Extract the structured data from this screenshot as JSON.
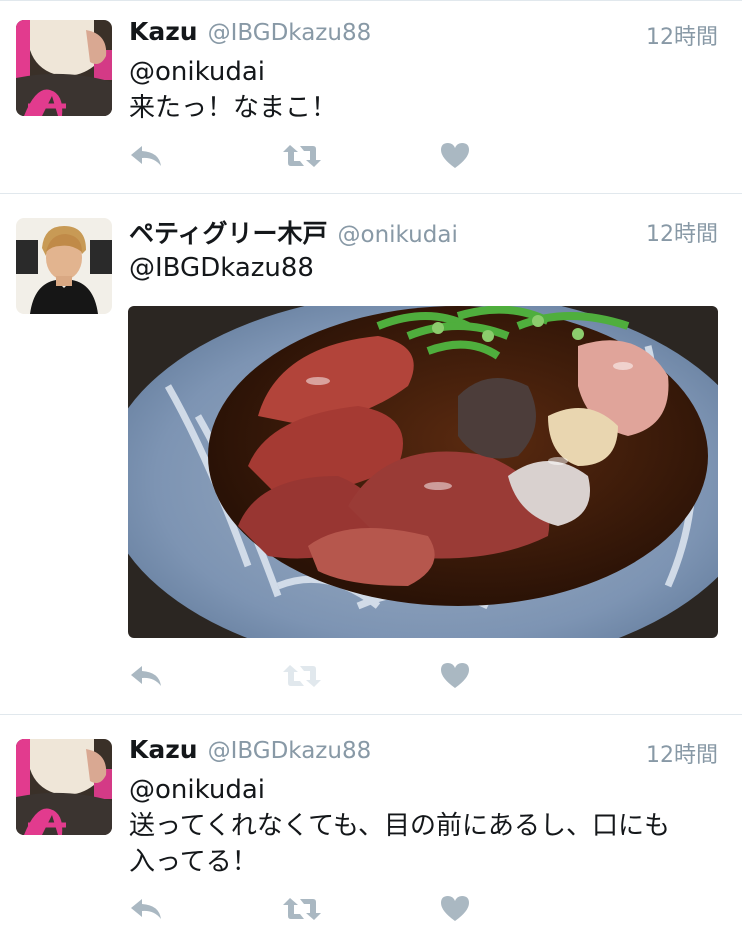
{
  "tweets": [
    {
      "name": "Kazu",
      "handle": "@IBGDkazu88",
      "time": "12時間",
      "reply_to": "@onikudai",
      "text": "来たっ！なまこ！",
      "avatar": "kazu-avatar"
    },
    {
      "name": "ペティグリー木戸",
      "handle": "@onikudai",
      "time": "12時間",
      "reply_to": "@IBGDkazu88",
      "text": "",
      "avatar": "kido-avatar",
      "media": "photo of sea cucumber sashimi with green onion in soy sauce on blue plate"
    },
    {
      "name": "Kazu",
      "handle": "@IBGDkazu88",
      "time": "12時間",
      "reply_to": "@onikudai",
      "text_line1": "送ってくれなくても、目の前にあるし、口にも",
      "text_line2": "入ってる！",
      "avatar": "kazu-avatar"
    }
  ],
  "icons": {
    "reply": "reply-icon",
    "retweet": "retweet-icon",
    "like": "heart-icon"
  },
  "colors": {
    "action_icon": "#aab8c2",
    "action_icon_disabled": "#e1e8ed",
    "secondary_text": "#8899a6",
    "divider": "#e1e8ed"
  }
}
